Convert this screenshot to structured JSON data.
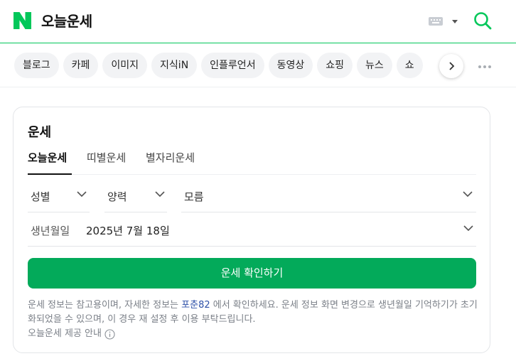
{
  "header": {
    "logo_letter": "N",
    "title": "오늘운세",
    "brand_color": "#03c75a",
    "keyboard_icon": "keyboard-icon",
    "search_icon": "search-icon"
  },
  "tabs": {
    "items": [
      {
        "label": "블로그"
      },
      {
        "label": "카페"
      },
      {
        "label": "이미지"
      },
      {
        "label": "지식iN"
      },
      {
        "label": "인플루언서"
      },
      {
        "label": "동영상"
      },
      {
        "label": "쇼핑"
      },
      {
        "label": "뉴스"
      },
      {
        "label": "쇼"
      }
    ],
    "next_icon": "chevron-right-icon",
    "more_icon": "more-dots-icon"
  },
  "card": {
    "title": "운세",
    "subtabs": [
      {
        "label": "오늘운세",
        "active": true
      },
      {
        "label": "띠별운세",
        "active": false
      },
      {
        "label": "별자리운세",
        "active": false
      }
    ],
    "gender_select": "성별",
    "calendar_select": "양력",
    "time_select": "모름",
    "dob_label": "생년월일",
    "dob_value": "2025년 7월 18일",
    "confirm_label": "운세 확인하기",
    "button_color": "#03aa5a",
    "notice_before": "운세 정보는 참고용이며, 자세한 정보는 ",
    "notice_link": "포춘82",
    "notice_after": " 에서 확인하세요. 운세 정보 화면 변경으로 생년월일 기억하기가 초기화되었을 수 있으며, 이 경우 재 설정 후 이용 부탁드립니다.",
    "guide_label": "오늘운세 제공 안내"
  }
}
